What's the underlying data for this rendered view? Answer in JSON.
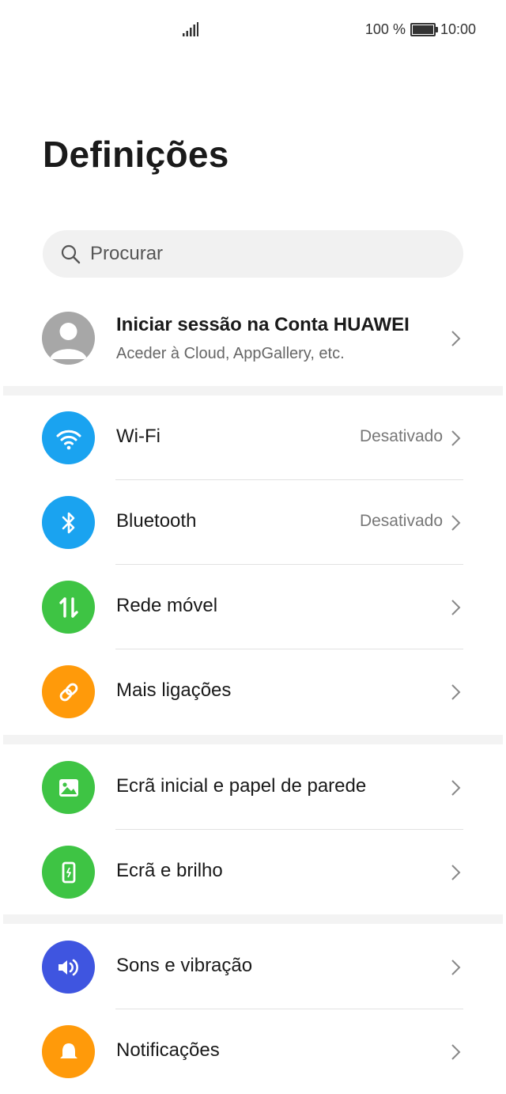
{
  "status_bar": {
    "battery": "100 %",
    "time": "10:00"
  },
  "header": {
    "title": "Definições"
  },
  "search": {
    "placeholder": "Procurar"
  },
  "account": {
    "title": "Iniciar sessão na Conta HUAWEI",
    "subtitle": "Aceder à Cloud, AppGallery, etc."
  },
  "settings": {
    "wifi": {
      "label": "Wi-Fi",
      "value": "Desativado",
      "icon": "wifi-icon",
      "color": "#1aa3f0"
    },
    "bluetooth": {
      "label": "Bluetooth",
      "value": "Desativado",
      "icon": "bluetooth-icon",
      "color": "#1aa3f0"
    },
    "mobile": {
      "label": "Rede móvel",
      "icon": "mobile-data-icon",
      "color": "#3ec444"
    },
    "more_connections": {
      "label": "Mais ligações",
      "icon": "link-icon",
      "color": "#ff9a0a"
    },
    "home_wallpaper": {
      "label": "Ecrã inicial e papel de parede",
      "icon": "wallpaper-icon",
      "color": "#3ec444"
    },
    "display": {
      "label": "Ecrã e brilho",
      "icon": "display-icon",
      "color": "#3ec444"
    },
    "sounds": {
      "label": "Sons e vibração",
      "icon": "speaker-icon",
      "color": "#3f55e0"
    },
    "notifications": {
      "label": "Notificações",
      "icon": "bell-icon",
      "color": "#ff9a0a"
    }
  }
}
